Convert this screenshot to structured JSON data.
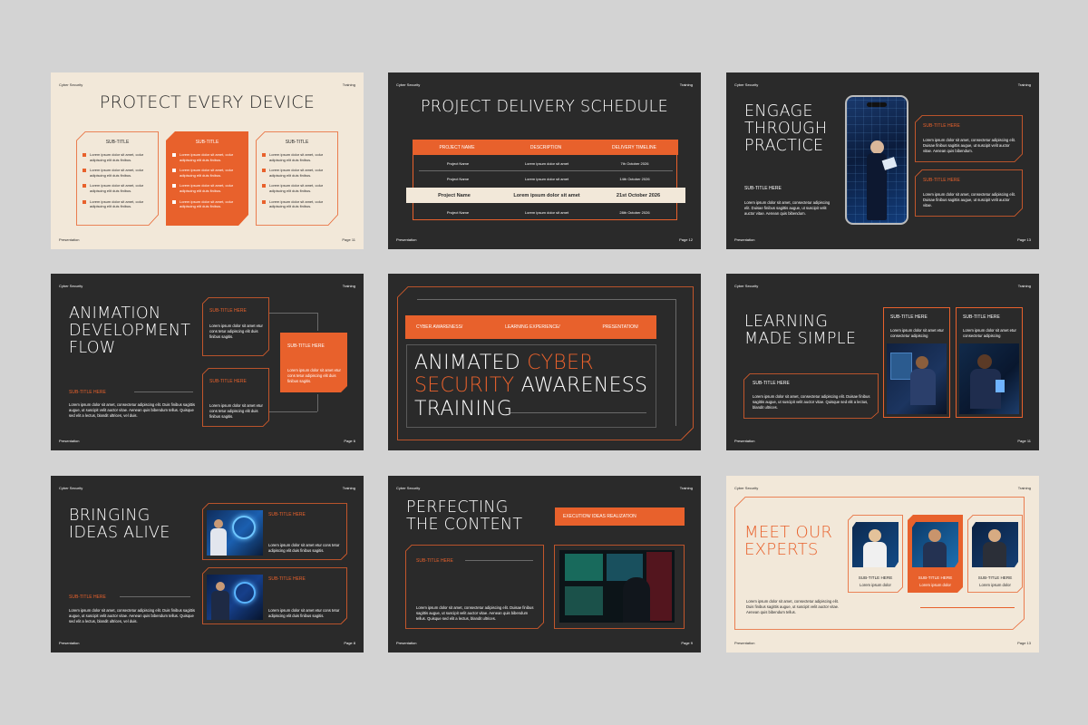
{
  "common": {
    "header_left": "Cyber Security",
    "header_right": "Training",
    "footer_left": "Presentation"
  },
  "s1": {
    "title": "PROTECT EVERY DEVICE",
    "page": "Page 11",
    "cards": [
      {
        "subtitle": "SUB-TITLE",
        "bullets": [
          "Lorem ipsum dolor sit amet, colur adipiscing elit duis finibus.",
          "Lorem ipsum dolor sit amet, colur adipiscing elit duis finibus.",
          "Lorem ipsum dolor sit amet, colur adipiscing elit duis finibus.",
          "Lorem ipsum dolor sit amet, colur adipiscing elit duis finibus."
        ]
      },
      {
        "subtitle": "SUB-TITLE",
        "bullets": [
          "Lorem ipsum dolor sit amet, colur adipiscing elit duis finibus.",
          "Lorem ipsum dolor sit amet, colur adipiscing elit duis finibus.",
          "Lorem ipsum dolor sit amet, colur adipiscing elit duis finibus.",
          "Lorem ipsum dolor sit amet, colur adipiscing elit duis finibus."
        ]
      },
      {
        "subtitle": "SUB-TITLE",
        "bullets": [
          "Lorem ipsum dolor sit amet, colur adipiscing elit duis finibus.",
          "Lorem ipsum dolor sit amet, colur adipiscing elit duis finibus.",
          "Lorem ipsum dolor sit amet, colur adipiscing elit duis finibus.",
          "Lorem ipsum dolor sit amet, colur adipiscing elit duis finibus."
        ]
      }
    ]
  },
  "s2": {
    "title": "PROJECT DELIVERY SCHEDULE",
    "page": "Page 12",
    "headers": [
      "PROJECT NAME",
      "DESCRIPTION",
      "DELIVERY TIMELINE"
    ],
    "rows": [
      [
        "Project Name",
        "Lorem ipsum dolor sit amet",
        "7th October 2026"
      ],
      [
        "Project Name",
        "Lorem ipsum dolor sit amet",
        "14th October 2026"
      ],
      [
        "Project Name",
        "Lorem ipsum dolor sit amet",
        "21st October 2026"
      ],
      [
        "Project Name",
        "Lorem ipsum dolor sit amet",
        "28th October 2026"
      ]
    ],
    "highlight_row": 2
  },
  "s3": {
    "title_lines": [
      "ENGAGE",
      "THROUGH",
      "PRACTICE"
    ],
    "subtitle": "SUB-TITLE HERE",
    "body": "Lorem ipsum dolor sit amet, consectetur adipiscing elit. Duisae finibus sagittis augue, ut suscipit velit auctor vitae. Aenean quis bibendum.",
    "page": "Page 13",
    "cards": [
      {
        "subtitle": "SUB-TITLE HERE",
        "body": "Lorem ipsum dolor sit amet, consectetur adipiscing elit. Duisae finibus sagittis augue, ut suscipit velit auctor vitae. Aenean quis bibendum."
      },
      {
        "subtitle": "SUB-TITLE HERE",
        "body": "Lorem ipsum dolor sit amet, consectetur adipiscing elit. Duisae finibus sagittis augue, ut suscipit velit auctor vitae."
      }
    ]
  },
  "s4": {
    "title_lines": [
      "ANIMATION",
      "DEVELOPMENT",
      "FLOW"
    ],
    "subtitle": "SUB-TITLE HERE",
    "body": "Lorem ipsum dolor sit amet, consectetur adipiscing elit. Duis finibus sagittis augue, ut suscipit velit auctor vitae. Aenean quis bibendum tellus. Quisque sed elit a lectus, blandit ultrices, vel duis.",
    "page": "Page 6",
    "boxes": [
      {
        "subtitle": "SUB-TITLE HERE",
        "body": "Lorem ipsum dolor sit amet etur cons tetur adipiscing elit duis finibus sagitis."
      },
      {
        "subtitle": "SUB-TITLE HERE",
        "body": "Lorem ipsum dolor sit amet etur cons tetur adipiscing elit duis finibus sagitis."
      },
      {
        "subtitle": "SUB-TITLE HERE",
        "body": "Lorem ipsum dolor sit amet etur cons tetur adipiscing elit duis finibus sagitis."
      }
    ]
  },
  "s5": {
    "tags": [
      "CYBER AWARENESS/",
      "LEARNING EXPERIENCE/",
      "PRESENTATION/"
    ],
    "title_l1a": "ANIMATED ",
    "title_l1b": "CYBER",
    "title_l2a": "SECURITY",
    "title_l2b": " AWARENESS",
    "title_l3": "TRAINING"
  },
  "s6": {
    "title_lines": [
      "LEARNING",
      "MADE SIMPLE"
    ],
    "subtitle": "SUB-TITLE HERE",
    "body": "Lorem ipsum dolor sit amet, consectetur adipiscing elit. Duisae finibus sagittis augue, ut suscipit velit auctor vitae. Quisque sed elit a lectus, blandit ultrices.",
    "page": "Page 11",
    "cards": [
      {
        "subtitle": "SUB-TITLE HERE",
        "body": "Lorem ipsum dolor sit amet etur consectetur adipiscing"
      },
      {
        "subtitle": "SUB-TITLE HERE",
        "body": "Lorem ipsum dolor sit amet etur consectetur adipiscing"
      }
    ]
  },
  "s7": {
    "title_lines": [
      "BRINGING",
      "IDEAS ALIVE"
    ],
    "subtitle": "SUB-TITLE HERE",
    "body": "Lorem ipsum dolor sit amet, consectetur adipiscing elit. Duis finibus sagittis augue, ut suscipit velit auctor vitae. Aenean quis bibendum tellus. Quisque sed elit a lectus, blandit ultrices, vel duis.",
    "page": "Page 8",
    "cards": [
      {
        "subtitle": "SUB-TITLE HERE",
        "body": "Lorem ipsum dolor sit amet etur cons tetur adipiscing elit duis finibus sagitis."
      },
      {
        "subtitle": "SUB-TITLE HERE",
        "body": "Lorem ipsum dolor sit amet etur cons tetur adipiscing elit duis finibus sagitis."
      }
    ]
  },
  "s8": {
    "title_lines": [
      "PERFECTING",
      "THE CONTENT"
    ],
    "tag": "EXECUTION/ IDEAS REALIZATION",
    "subtitle": "SUB-TITLE HERE",
    "body": "Lorem ipsum dolor sit amet, consectetur adipiscing elit. Duisae finibus sagittis augue, ut suscipit velit auctor vitae. Aenean quis bibendum tellus. Quisque sed elit a lectus, blandit ultrices.",
    "page": "Page 9"
  },
  "s9": {
    "title_lines": [
      "MEET OUR",
      "EXPERTS"
    ],
    "body": "Lorem ipsum dolor sit amet, consectetur adipiscing elit. Duis finibus sagittis augue, ut suscipit velit auctor vitae. Aenean quis bibendum tellus.",
    "page": "Page 13",
    "experts": [
      {
        "subtitle": "SUB-TITLE HERE",
        "caption": "Lorem ipsum dolor"
      },
      {
        "subtitle": "SUB-TITLE HERE",
        "caption": "Lorem ipsum dolor"
      },
      {
        "subtitle": "SUB-TITLE HERE",
        "caption": "Lorem ipsum dolor"
      }
    ]
  },
  "colors": {
    "accent": "#e8612c",
    "dark_bg": "#2a2a2a",
    "cream_bg": "#f2e8d9",
    "page_bg": "#d3d3d3"
  }
}
